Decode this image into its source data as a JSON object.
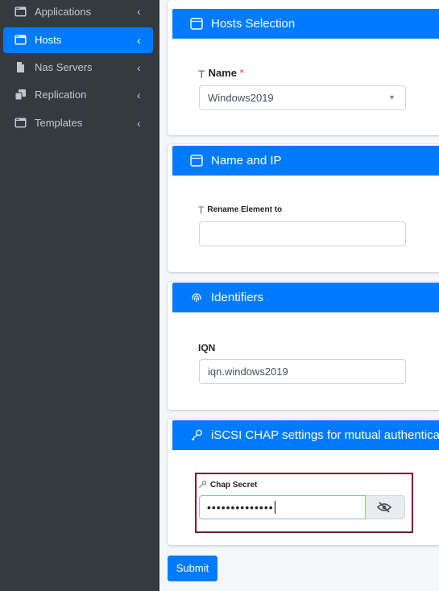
{
  "sidebar": {
    "items": [
      {
        "label": "Applications",
        "icon": "window-icon",
        "active": false
      },
      {
        "label": "Hosts",
        "icon": "window-icon",
        "active": true
      },
      {
        "label": "Nas Servers",
        "icon": "file-icon",
        "active": false
      },
      {
        "label": "Replication",
        "icon": "copy-icon",
        "active": false
      },
      {
        "label": "Templates",
        "icon": "window-icon",
        "active": false
      }
    ],
    "chevron": "‹"
  },
  "cards": {
    "hosts_selection": {
      "title": "Hosts Selection",
      "field_label": "Name",
      "required_mark": "*",
      "selected_value": "Windows2019"
    },
    "name_ip": {
      "title": "Name and IP",
      "field_label": "Rename Element to",
      "value": ""
    },
    "identifiers": {
      "title": "Identifiers",
      "field_label": "IQN",
      "value": "iqn.windows2019"
    },
    "chap": {
      "title": "iSCSI CHAP settings for mutual authentication",
      "field_label": "Chap Secret",
      "masked_value": "••••••••••••••"
    }
  },
  "submit_label": "Submit",
  "colors": {
    "accent": "#007bff",
    "sidebar_bg": "#343a40",
    "highlight": "#7b1c2a",
    "required": "#dc3545"
  }
}
